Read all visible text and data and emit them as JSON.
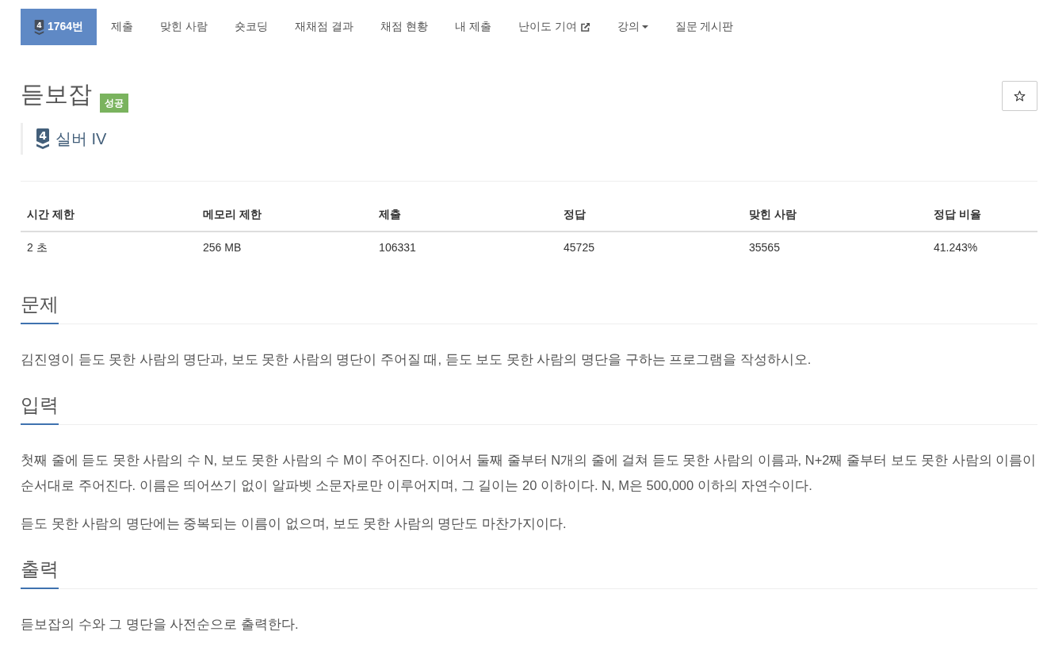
{
  "nav": {
    "tabs": [
      {
        "kind": "problem",
        "tier": "4",
        "label": "1764번",
        "selected": true
      },
      {
        "kind": "page",
        "label": "제출",
        "selected": false
      },
      {
        "kind": "page",
        "label": "맞힌 사람",
        "selected": false
      },
      {
        "kind": "page",
        "label": "숏코딩",
        "selected": false
      },
      {
        "kind": "page",
        "label": "재채점 결과",
        "selected": false
      },
      {
        "kind": "page",
        "label": "채점 현황",
        "selected": false
      },
      {
        "kind": "page",
        "label": "내 제출",
        "selected": false
      },
      {
        "kind": "external",
        "label": "난이도 기여",
        "selected": false
      },
      {
        "kind": "dropdown",
        "label": "강의",
        "selected": false
      },
      {
        "kind": "page",
        "label": "질문 게시판",
        "selected": false
      }
    ]
  },
  "problem": {
    "title": "듣보잡",
    "result": {
      "label": "성공",
      "kind": "success"
    },
    "tier": {
      "number": "4",
      "name": "실버 IV"
    }
  },
  "stats": {
    "columns": [
      "시간 제한",
      "메모리 제한",
      "제출",
      "정답",
      "맞힌 사람",
      "정답 비율"
    ],
    "rows": [
      [
        "2 초",
        "256 MB",
        "106331",
        "45725",
        "35565",
        "41.243%"
      ]
    ]
  },
  "sections": [
    {
      "title": "문제",
      "paragraphs": [
        "김진영이 듣도 못한 사람의 명단과, 보도 못한 사람의 명단이 주어질 때, 듣도 보도 못한 사람의 명단을 구하는 프로그램을 작성하시오."
      ]
    },
    {
      "title": "입력",
      "paragraphs": [
        "첫째 줄에 듣도 못한 사람의 수 N, 보도 못한 사람의 수 M이 주어진다. 이어서 둘째 줄부터 N개의 줄에 걸쳐 듣도 못한 사람의 이름과, N+2째 줄부터 보도 못한 사람의 이름이 순서대로 주어진다. 이름은 띄어쓰기 없이 알파벳 소문자로만 이루어지며, 그 길이는 20 이하이다. N, M은 500,000 이하의 자연수이다.",
        "듣도 못한 사람의 명단에는 중복되는 이름이 없으며, 보도 못한 사람의 명단도 마찬가지이다."
      ]
    },
    {
      "title": "출력",
      "paragraphs": [
        "듣보잡의 수와 그 명단을 사전순으로 출력한다."
      ]
    }
  ]
}
